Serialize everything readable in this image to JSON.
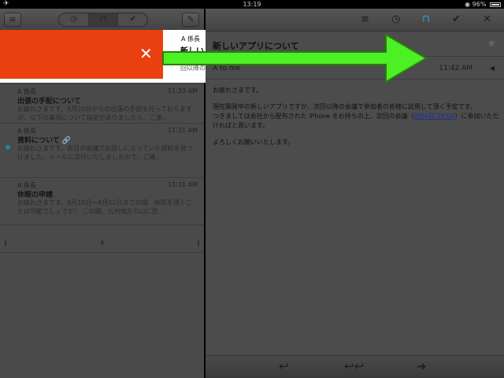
{
  "status_bar": {
    "airplane_icon": "airplane-icon",
    "time": "13:19",
    "battery_text": "96%"
  },
  "left_toolbar": {
    "menu_icon": "≡",
    "segments": [
      {
        "icon": "clock-icon",
        "glyph": "◷"
      },
      {
        "icon": "inbox-icon",
        "glyph": "⊓"
      },
      {
        "icon": "check-icon",
        "glyph": "✔"
      }
    ],
    "compose_icon": "✎"
  },
  "swiped_message": {
    "sender": "A 係長",
    "subject": "新しい",
    "preview": "回以降の",
    "delete_glyph": "✕",
    "delete_color": "#e8400f"
  },
  "messages": [
    {
      "sender": "A 係長",
      "time": "11:33 AM",
      "subject": "出張の手配について",
      "preview": "お疲れさまです。6月20日からの出張の手配を行っておりますが、以下の事項について指定がありましたら、ご連...",
      "unread": false,
      "attachment": false
    },
    {
      "sender": "A 係長",
      "time": "11:31 AM",
      "subject": "資料について",
      "preview": "お疲れさまです。先日の会議でお探しになっていた資料を見つけました。メールに添付いたしましたので、ご確...",
      "unread": true,
      "attachment": true
    },
    {
      "sender": "A 係長",
      "time": "11:31 AM",
      "subject": "休暇の申請",
      "preview": "お疲れさまです。6月10日〜6月12日までの間、休暇を頂くことは可能でしょうか？ この間、九州地方の山に登...",
      "unread": false,
      "attachment": false
    }
  ],
  "pager": {
    "page": "4"
  },
  "right_toolbar": {
    "icons": [
      {
        "name": "menu-icon",
        "glyph": "≡"
      },
      {
        "name": "clock-icon",
        "glyph": "◷"
      },
      {
        "name": "inbox-icon",
        "glyph": "⊓"
      },
      {
        "name": "check-icon",
        "glyph": "✔"
      },
      {
        "name": "close-icon",
        "glyph": "✕"
      }
    ],
    "active_color": "#3a9bd5"
  },
  "email": {
    "subject": "新しいアプリについて",
    "star_glyph": "★",
    "recipient": "A to me",
    "time": "11:42 AM",
    "expand_glyph": "◀",
    "greeting": "お疲れさまです。",
    "para1_line1": "現在開発中の新しいアプリですが、次回以降の会議で参加者の皆様に試用して頂く予定です。",
    "para1_line2_a": "つきましては会社から配布された iPhone をお持ちの上、次回の会議（",
    "para1_link": "6月4日 15:00",
    "para1_line2_b": "）に参加いただければと思います。",
    "closing": "よろしくお願いいたします。"
  },
  "bottom_bar": {
    "reply": "↩",
    "reply_all": "↩↩",
    "forward": "➜"
  },
  "overlay": {
    "arrow_color": "#4cf024"
  }
}
